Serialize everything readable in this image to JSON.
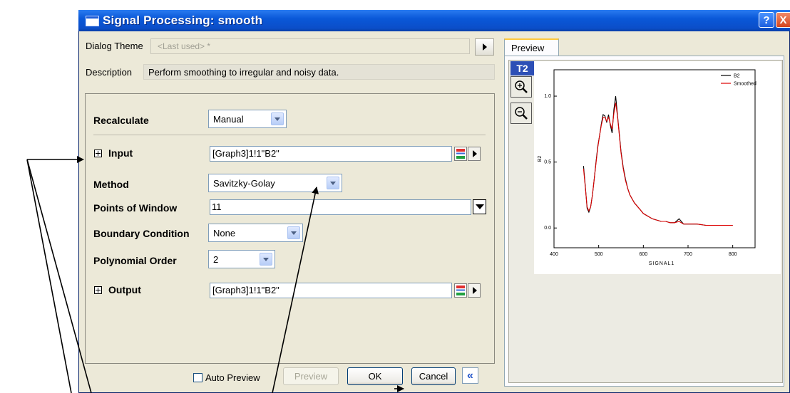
{
  "window": {
    "title": "Signal Processing: smooth",
    "help_glyph": "?",
    "close_glyph": "X"
  },
  "theme": {
    "label": "Dialog Theme",
    "value": "<Last used> *"
  },
  "description": {
    "label": "Description",
    "text": "Perform smoothing to irregular and noisy data."
  },
  "params": {
    "recalculate": {
      "label": "Recalculate",
      "value": "Manual"
    },
    "input": {
      "label": "Input",
      "value": "[Graph3]1!1\"B2\""
    },
    "method": {
      "label": "Method",
      "value": "Savitzky-Golay"
    },
    "points_of_window": {
      "label": "Points of Window",
      "value": "11"
    },
    "boundary_condition": {
      "label": "Boundary Condition",
      "value": "None"
    },
    "polynomial_order": {
      "label": "Polynomial Order",
      "value": "2"
    },
    "output": {
      "label": "Output",
      "value": "[Graph3]1!1\"B2\""
    }
  },
  "buttons": {
    "auto_preview": "Auto Preview",
    "preview": "Preview",
    "ok": "OK",
    "cancel": "Cancel",
    "collapse": "«"
  },
  "preview": {
    "tab": "Preview",
    "layer": "T2",
    "zoom_in": "+",
    "zoom_out": "−"
  },
  "chart_data": {
    "type": "line",
    "xlabel": "SIGNAL1",
    "ylabel": "B2",
    "xlim": [
      400,
      850
    ],
    "ylim": [
      -0.15,
      1.2
    ],
    "xticks": [
      "400",
      "500",
      "600",
      "700",
      "800"
    ],
    "yticks": [
      "0.0",
      "0.5",
      "1.0"
    ],
    "legend_position": "top-right",
    "series": [
      {
        "name": "B2",
        "color": "#000000",
        "x": [
          466,
          470,
          474,
          478,
          482,
          486,
          490,
          494,
          498,
          502,
          506,
          510,
          514,
          518,
          522,
          526,
          530,
          534,
          538,
          542,
          546,
          550,
          555,
          560,
          565,
          570,
          580,
          590,
          600,
          610,
          620,
          630,
          640,
          650,
          660,
          670,
          680,
          690,
          700,
          720,
          740,
          760,
          780,
          800
        ],
        "y": [
          0.47,
          0.32,
          0.15,
          0.12,
          0.16,
          0.25,
          0.37,
          0.5,
          0.62,
          0.7,
          0.79,
          0.86,
          0.85,
          0.8,
          0.86,
          0.78,
          0.72,
          0.9,
          1.0,
          0.86,
          0.72,
          0.58,
          0.46,
          0.37,
          0.3,
          0.25,
          0.19,
          0.15,
          0.11,
          0.09,
          0.07,
          0.06,
          0.05,
          0.05,
          0.04,
          0.04,
          0.07,
          0.03,
          0.03,
          0.03,
          0.02,
          0.02,
          0.02,
          0.02
        ]
      },
      {
        "name": "Smoothed",
        "color": "#dd0000",
        "x": [
          466,
          470,
          474,
          478,
          482,
          486,
          490,
          494,
          498,
          502,
          506,
          510,
          514,
          518,
          522,
          526,
          530,
          534,
          538,
          542,
          546,
          550,
          555,
          560,
          565,
          570,
          580,
          590,
          600,
          610,
          620,
          630,
          640,
          650,
          660,
          670,
          680,
          690,
          700,
          720,
          740,
          760,
          780,
          800
        ],
        "y": [
          0.45,
          0.31,
          0.16,
          0.13,
          0.16,
          0.25,
          0.37,
          0.49,
          0.61,
          0.7,
          0.78,
          0.84,
          0.84,
          0.81,
          0.84,
          0.79,
          0.75,
          0.87,
          0.95,
          0.85,
          0.71,
          0.57,
          0.45,
          0.36,
          0.3,
          0.25,
          0.19,
          0.15,
          0.11,
          0.09,
          0.07,
          0.06,
          0.05,
          0.05,
          0.04,
          0.04,
          0.05,
          0.03,
          0.03,
          0.03,
          0.02,
          0.02,
          0.02,
          0.02
        ]
      }
    ]
  }
}
